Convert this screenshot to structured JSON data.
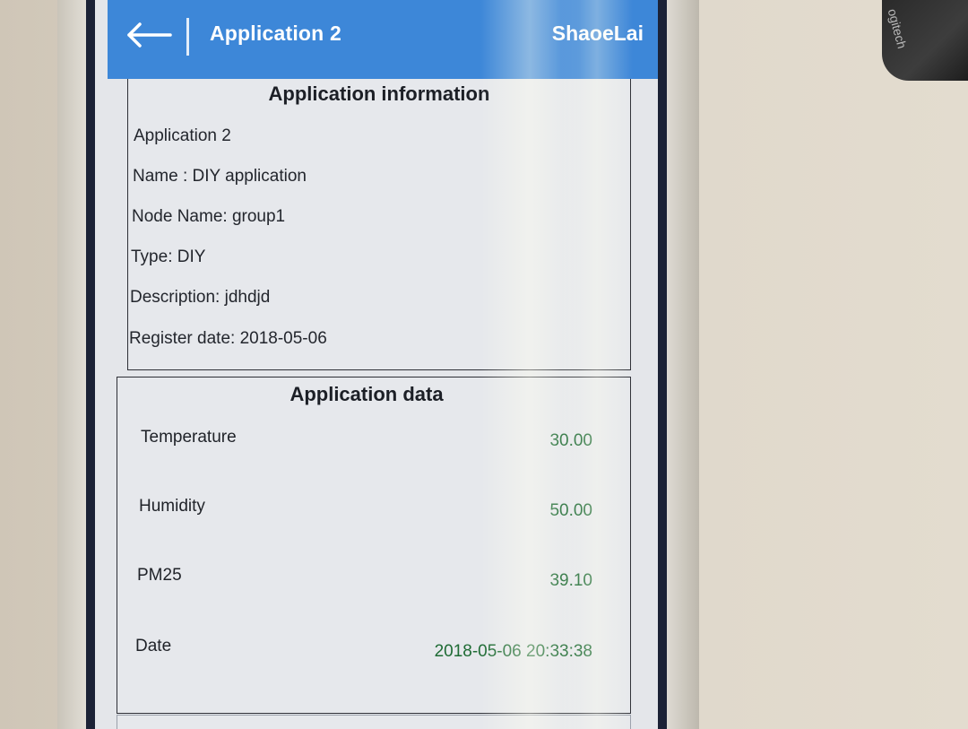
{
  "app_bar": {
    "title": "Application 2",
    "user": "ShaoeLai",
    "color": "#3d87d8"
  },
  "info_card": {
    "heading": "Application information",
    "lines": [
      "Application 2",
      "Name : DIY application",
      "Node Name: group1",
      "Type: DIY",
      "Description: jdhdjd",
      "Register date: 2018-05-06"
    ]
  },
  "data_card": {
    "heading": "Application data",
    "rows": [
      {
        "label": "Temperature",
        "value": "30.00"
      },
      {
        "label": "Humidity",
        "value": "50.00"
      },
      {
        "label": "PM25",
        "value": "39.10"
      },
      {
        "label": "Date",
        "value": "2018-05-06 20:33:38"
      }
    ],
    "value_color": "#1e6b34"
  },
  "background_object": {
    "text": "ogitech"
  },
  "icons": {
    "back": "arrow-left-icon"
  }
}
